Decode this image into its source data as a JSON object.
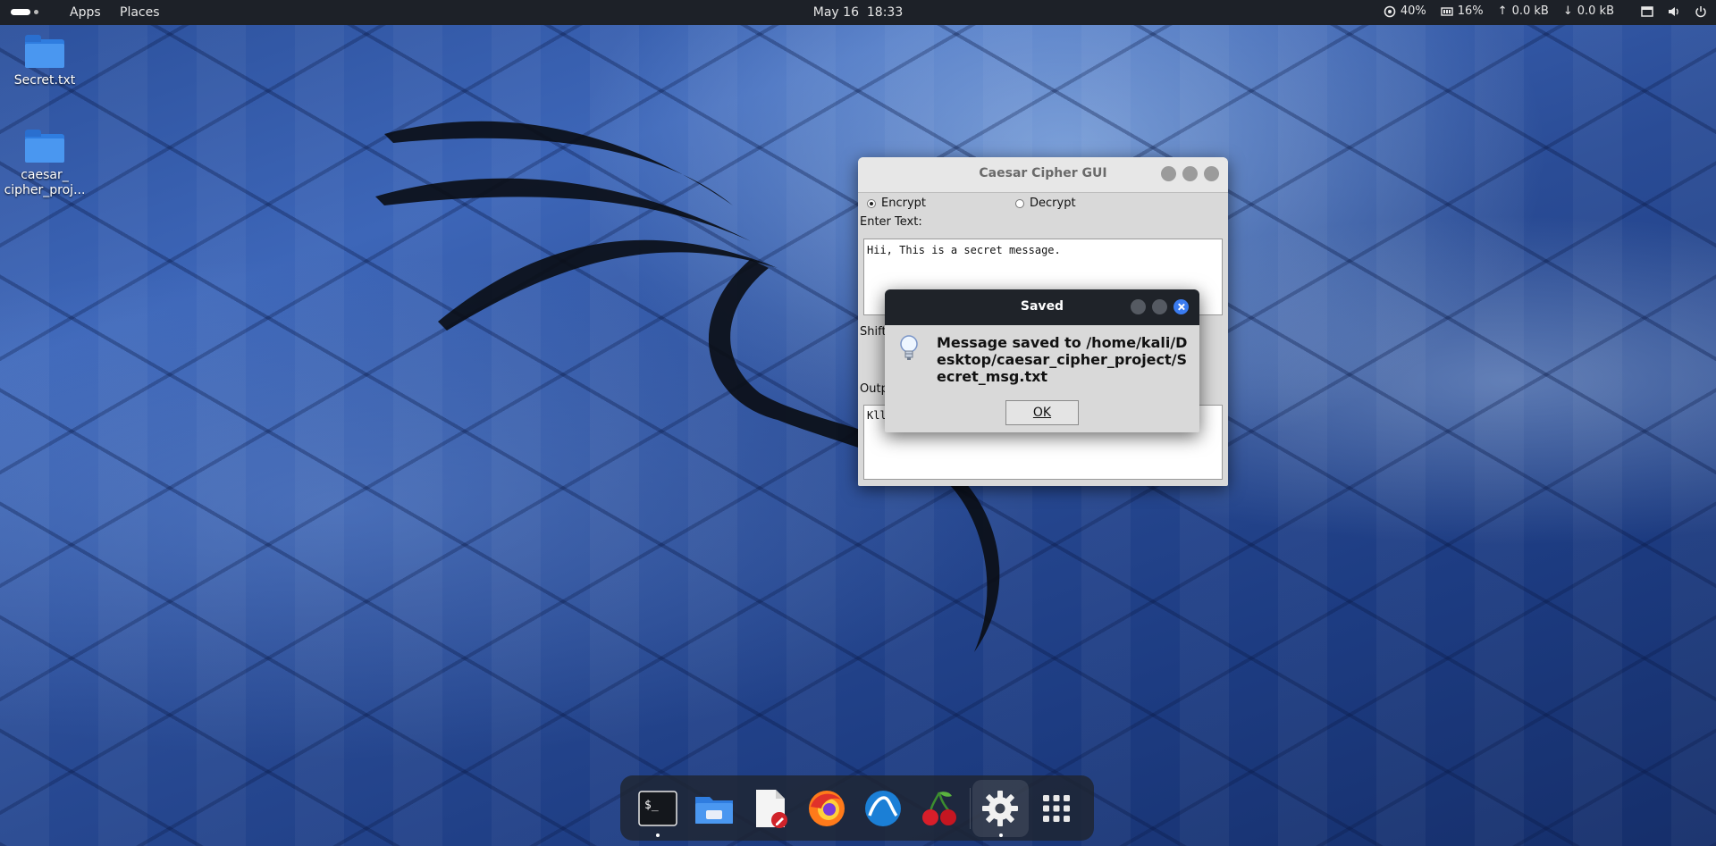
{
  "topbar": {
    "apps_label": "Apps",
    "places_label": "Places",
    "datetime": "May 16  18:33",
    "cpu": "40%",
    "mem": "16%",
    "upload": "0.0 kB",
    "download": "0.0 kB"
  },
  "desktop": {
    "icons": [
      {
        "label": "Secret.txt",
        "icon": "folder-icon"
      },
      {
        "label": "caesar_\ncipher_proj...",
        "icon": "folder-icon"
      }
    ]
  },
  "caesar_window": {
    "title": "Caesar Cipher GUI",
    "mode_encrypt": "Encrypt",
    "mode_decrypt": "Decrypt",
    "selected_mode": "Encrypt",
    "enter_text_label": "Enter Text:",
    "input_text": "Hii, This is a secret message.",
    "shift_label": "Shift",
    "output_label": "Outp",
    "output_text": "Kll"
  },
  "dialog": {
    "title": "Saved",
    "message": "Message saved to /home/kali/Desktop/caesar_cipher_project/Secret_msg.txt",
    "ok_label": "OK",
    "icon": "lightbulb-icon"
  },
  "dock": {
    "items": [
      "terminal-icon",
      "files-icon",
      "text-editor-icon",
      "firefox-icon",
      "wireshark-icon",
      "cherrytree-icon",
      "settings-icon",
      "app-grid-icon"
    ]
  },
  "colors": {
    "topbar_bg": "#1d2128",
    "dialog_titlebar": "#1f2329",
    "close_button": "#3a7bf0",
    "window_bg": "#d9d9d9"
  }
}
